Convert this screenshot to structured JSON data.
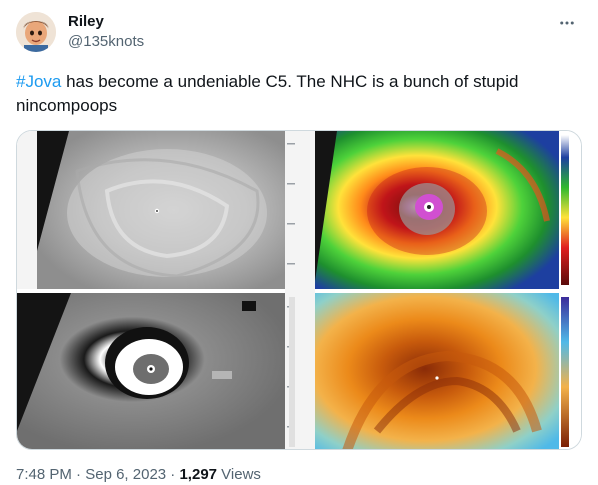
{
  "author": {
    "display_name": "Riley",
    "handle": "@135knots",
    "avatar": "cartoon-avatar-icon"
  },
  "menu_icon": "more-horizontal-icon",
  "tweet": {
    "hashtag": "#Jova",
    "text_rest": " has become a undeniable C5. The NHC is a bunch of stupid nincompoops"
  },
  "media": {
    "alt": "satellite-imagery-collage",
    "panels": [
      "visible-satellite-panel",
      "infrared-color-panel",
      "infrared-bw-enhanced-panel",
      "water-vapor-color-panel"
    ]
  },
  "meta": {
    "time": "7:48 PM",
    "separator": " · ",
    "date": "Sep 6, 2023",
    "views_count": "1,297",
    "views_label": " Views"
  },
  "colors": {
    "accent": "#1d9bf0",
    "text_primary": "#0f1419",
    "text_secondary": "#536471",
    "border": "#cfd9de"
  }
}
